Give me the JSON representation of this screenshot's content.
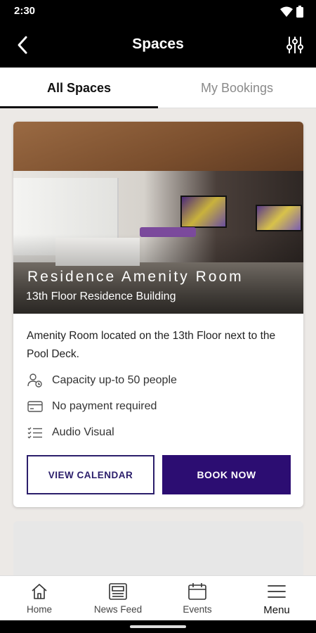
{
  "status_bar": {
    "time": "2:30"
  },
  "app_bar": {
    "title": "Spaces"
  },
  "tabs": [
    {
      "label": "All Spaces",
      "active": true
    },
    {
      "label": "My Bookings",
      "active": false
    }
  ],
  "space_card": {
    "name": "Residence Amenity Room",
    "location": "13th Floor Residence Building",
    "description": "Amenity Room located on the 13th Floor next to the Pool Deck.",
    "features": [
      {
        "icon": "capacity-icon",
        "label": "Capacity up-to 50 people"
      },
      {
        "icon": "payment-card-icon",
        "label": "No payment required"
      },
      {
        "icon": "checklist-icon",
        "label": "Audio Visual"
      }
    ],
    "view_calendar_label": "VIEW CALENDAR",
    "book_now_label": "BOOK NOW"
  },
  "bottom_nav": [
    {
      "label": "Home",
      "icon": "home-icon"
    },
    {
      "label": "News Feed",
      "icon": "news-feed-icon"
    },
    {
      "label": "Events",
      "icon": "calendar-icon"
    },
    {
      "label": "Menu",
      "icon": "menu-icon"
    }
  ],
  "colors": {
    "primary": "#2c0d72",
    "appbar": "#000000",
    "background": "#ece9e6"
  }
}
